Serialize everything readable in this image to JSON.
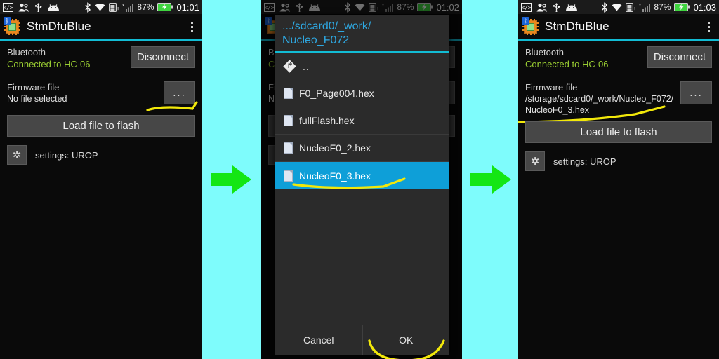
{
  "statusbar": {
    "icons": [
      "code-icon",
      "people-icon",
      "usb-icon",
      "android-icon",
      "bluetooth-icon",
      "wifi-icon",
      "sdcard-warning-icon",
      "signal-bars-icon",
      "battery-charging-icon"
    ],
    "battery_pct": "87%",
    "clock_panel1": "01:01",
    "clock_panel2": "01:02",
    "clock_panel3": "01:03"
  },
  "app": {
    "title": "StmDfuBlue",
    "icon": "chip-bluetooth-icon",
    "overflow": "overflow-menu-icon"
  },
  "panel1": {
    "bluetooth_label": "Bluetooth",
    "bluetooth_status": "Connected to HC-06",
    "disconnect_label": "Disconnect",
    "firmware_label": "Firmware file",
    "firmware_value": "No file selected",
    "browse_label": "...",
    "load_label": "Load file to flash",
    "settings_label": "settings: UROP",
    "settings_icon": "gear-icon"
  },
  "panel3": {
    "bluetooth_label": "Bluetooth",
    "bluetooth_status": "Connected to HC-06",
    "disconnect_label": "Disconnect",
    "firmware_label": "Firmware file",
    "firmware_value": "/storage/sdcard0/_work/Nucleo_F072/NucleoF0_3.hex",
    "browse_label": "...",
    "load_label": "Load file to flash",
    "settings_label": "settings: UROP",
    "settings_icon": "gear-icon"
  },
  "dialog": {
    "title_line1": ".../sdcard0/_work/",
    "title_line2": "Nucleo_F072",
    "parent_entry": "..",
    "files": [
      {
        "name": "F0_Page004.hex",
        "selected": false
      },
      {
        "name": "fullFlash.hex",
        "selected": false
      },
      {
        "name": "NucleoF0_2.hex",
        "selected": false
      },
      {
        "name": "NucleoF0_3.hex",
        "selected": true
      }
    ],
    "cancel_label": "Cancel",
    "ok_label": "OK"
  },
  "annotations": {
    "arrow1": "green-right-arrow",
    "arrow2": "green-right-arrow",
    "highlight_color": "#f2e80a"
  },
  "colors": {
    "accent_cyan": "#12bcd4",
    "gap_background": "#7efcfc",
    "arrow_green": "#14e614",
    "selection_blue": "#0e9fd8",
    "status_green": "#9acd32",
    "highlight_yellow": "#f2e80a"
  }
}
